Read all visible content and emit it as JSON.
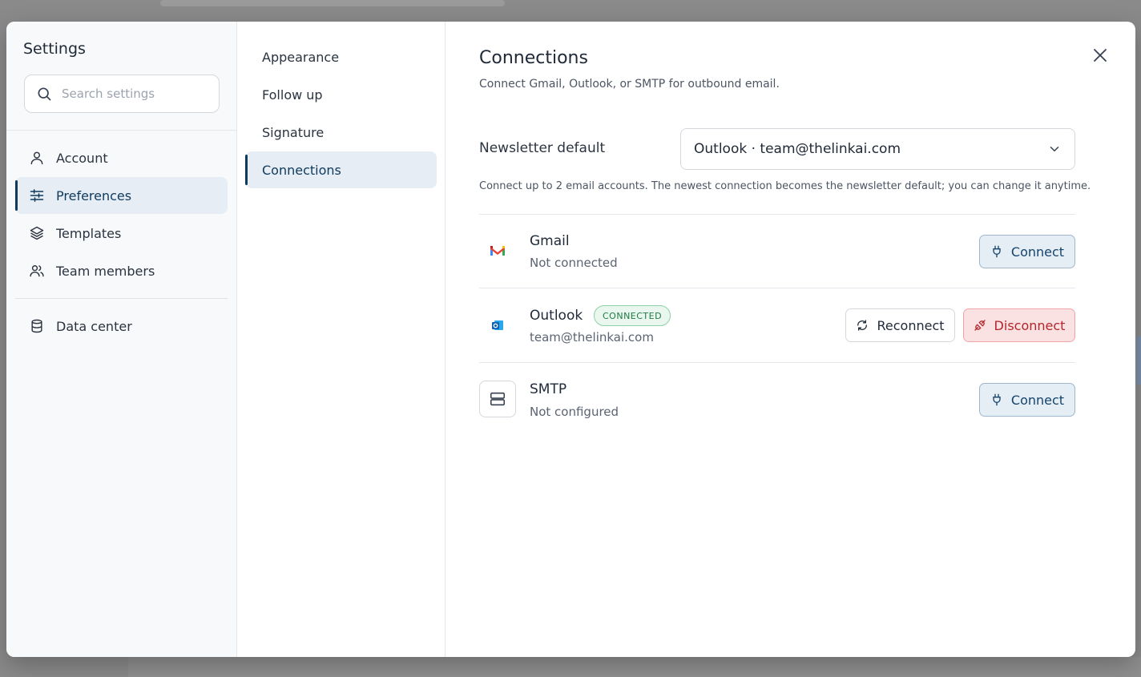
{
  "sidebar": {
    "title": "Settings",
    "search_placeholder": "Search settings",
    "items": [
      {
        "label": "Account",
        "icon": "user-icon"
      },
      {
        "label": "Preferences",
        "icon": "sliders-icon"
      },
      {
        "label": "Templates",
        "icon": "layers-icon"
      },
      {
        "label": "Team members",
        "icon": "users-icon"
      },
      {
        "label": "Data center",
        "icon": "database-icon"
      }
    ],
    "active": "Preferences"
  },
  "subnav": {
    "items": [
      "Appearance",
      "Follow up",
      "Signature",
      "Connections"
    ],
    "active": "Connections"
  },
  "main": {
    "title": "Connections",
    "subtitle": "Connect Gmail, Outlook, or SMTP for outbound email.",
    "newsletter_label": "Newsletter default",
    "newsletter_value": "Outlook · team@thelinkai.com",
    "helper": "Connect up to 2 email accounts. The newest connection becomes the newsletter default; you can change it anytime.",
    "accounts": [
      {
        "name": "Gmail",
        "status": "Not connected",
        "action": "Connect"
      },
      {
        "name": "Outlook",
        "badge": "CONNECTED",
        "status": "team@thelinkai.com",
        "reconnect": "Reconnect",
        "disconnect": "Disconnect"
      },
      {
        "name": "SMTP",
        "status": "Not configured",
        "action": "Connect"
      }
    ]
  },
  "colors": {
    "accent": "#0f3a5c",
    "connected_green": "#1f7a45",
    "danger_red": "#b3262c"
  }
}
